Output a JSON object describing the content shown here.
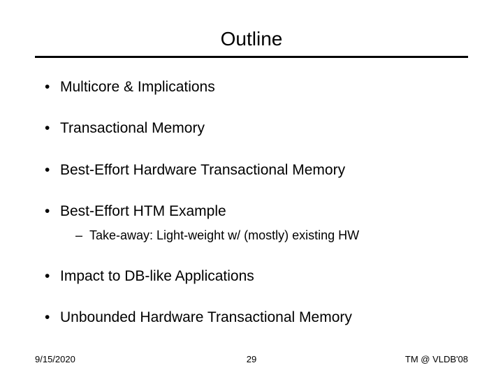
{
  "title": "Outline",
  "bullets": [
    {
      "text": "Multicore & Implications"
    },
    {
      "text": "Transactional Memory"
    },
    {
      "text": "Best-Effort Hardware Transactional Memory"
    },
    {
      "text": "Best-Effort HTM Example",
      "sub": [
        "Take-away: Light-weight w/ (mostly) existing HW"
      ]
    },
    {
      "text": "Impact to DB-like Applications"
    },
    {
      "text": "Unbounded Hardware Transactional Memory"
    }
  ],
  "footer": {
    "date": "9/15/2020",
    "page": "29",
    "venue": "TM @ VLDB'08"
  }
}
